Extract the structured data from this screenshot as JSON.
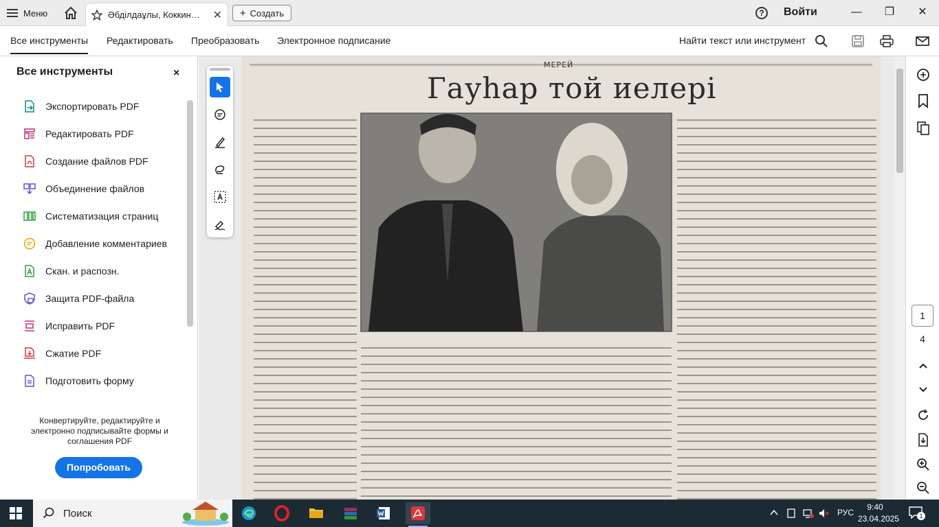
{
  "titlebar": {
    "menu_label": "Меню",
    "tab_title": "Әбділдаұлы, Коккин…",
    "tab_close": "✕",
    "create_label": "Создать",
    "help_glyph": "?",
    "login_label": "Войти",
    "minimize_glyph": "—",
    "restore_glyph": "❐",
    "close_glyph": "✕"
  },
  "toolbar": {
    "tabs": [
      {
        "label": "Все инструменты"
      },
      {
        "label": "Редактировать"
      },
      {
        "label": "Преобразовать"
      },
      {
        "label": "Электронное подписание"
      }
    ],
    "find_label": "Найти текст или инструмент"
  },
  "sidebar": {
    "title": "Все инструменты",
    "close_glyph": "×",
    "items": [
      {
        "label": "Экспортировать PDF",
        "icon": "export-pdf-icon"
      },
      {
        "label": "Редактировать PDF",
        "icon": "edit-pdf-icon"
      },
      {
        "label": "Создание файлов PDF",
        "icon": "create-pdf-icon"
      },
      {
        "label": "Объединение файлов",
        "icon": "combine-files-icon"
      },
      {
        "label": "Систематизация страниц",
        "icon": "organize-pages-icon"
      },
      {
        "label": "Добавление комментариев",
        "icon": "comment-icon"
      },
      {
        "label": "Скан. и распозн.",
        "icon": "scan-ocr-icon"
      },
      {
        "label": "Защита PDF-файла",
        "icon": "protect-pdf-icon"
      },
      {
        "label": "Исправить PDF",
        "icon": "redact-pdf-icon"
      },
      {
        "label": "Сжатие PDF",
        "icon": "compress-pdf-icon"
      },
      {
        "label": "Подготовить форму",
        "icon": "prepare-form-icon"
      }
    ],
    "promo_text": "Конвертируйте, редактируйте и электронно подписывайте формы и соглашения PDF",
    "try_label": "Попробовать"
  },
  "document": {
    "section_label": "МЕРЕЙ",
    "headline": "Гауһар той иелері"
  },
  "pagination": {
    "current_page": "1",
    "total_pages": "4"
  },
  "taskbar": {
    "search_label": "Поиск",
    "language": "РУС",
    "time": "9:40",
    "date": "23.04.2025",
    "notification_count": "1"
  },
  "colors": {
    "accent": "#1473e6",
    "pdf_red": "#d7373f",
    "taskbar": "#1b2a33"
  }
}
